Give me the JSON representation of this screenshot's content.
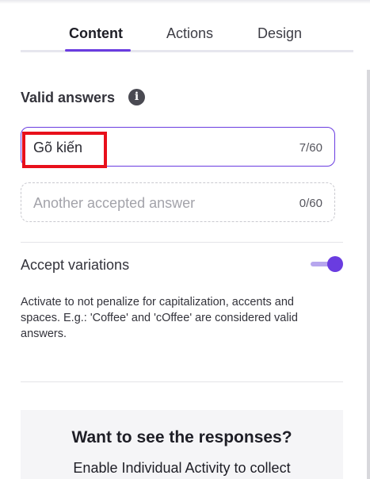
{
  "tabs": [
    {
      "label": "Content",
      "active": true
    },
    {
      "label": "Actions",
      "active": false
    },
    {
      "label": "Design",
      "active": false
    }
  ],
  "valid_answers": {
    "title": "Valid answers",
    "info_icon": "info-icon",
    "answers": [
      {
        "value": "Gõ kiến",
        "counter": "7/60"
      },
      {
        "value": "",
        "placeholder": "Another accepted answer",
        "counter": "0/60"
      }
    ]
  },
  "accept_variations": {
    "label": "Accept variations",
    "enabled": true,
    "description": "Activate to not penalize for capitalization, accents and spaces. E.g.: 'Coffee' and 'cOffee' are considered valid answers."
  },
  "promo": {
    "title": "Want to see the responses?",
    "text": "Enable Individual Activity to collect"
  },
  "colors": {
    "accent": "#6a3ce0",
    "highlight": "#e8101b"
  }
}
